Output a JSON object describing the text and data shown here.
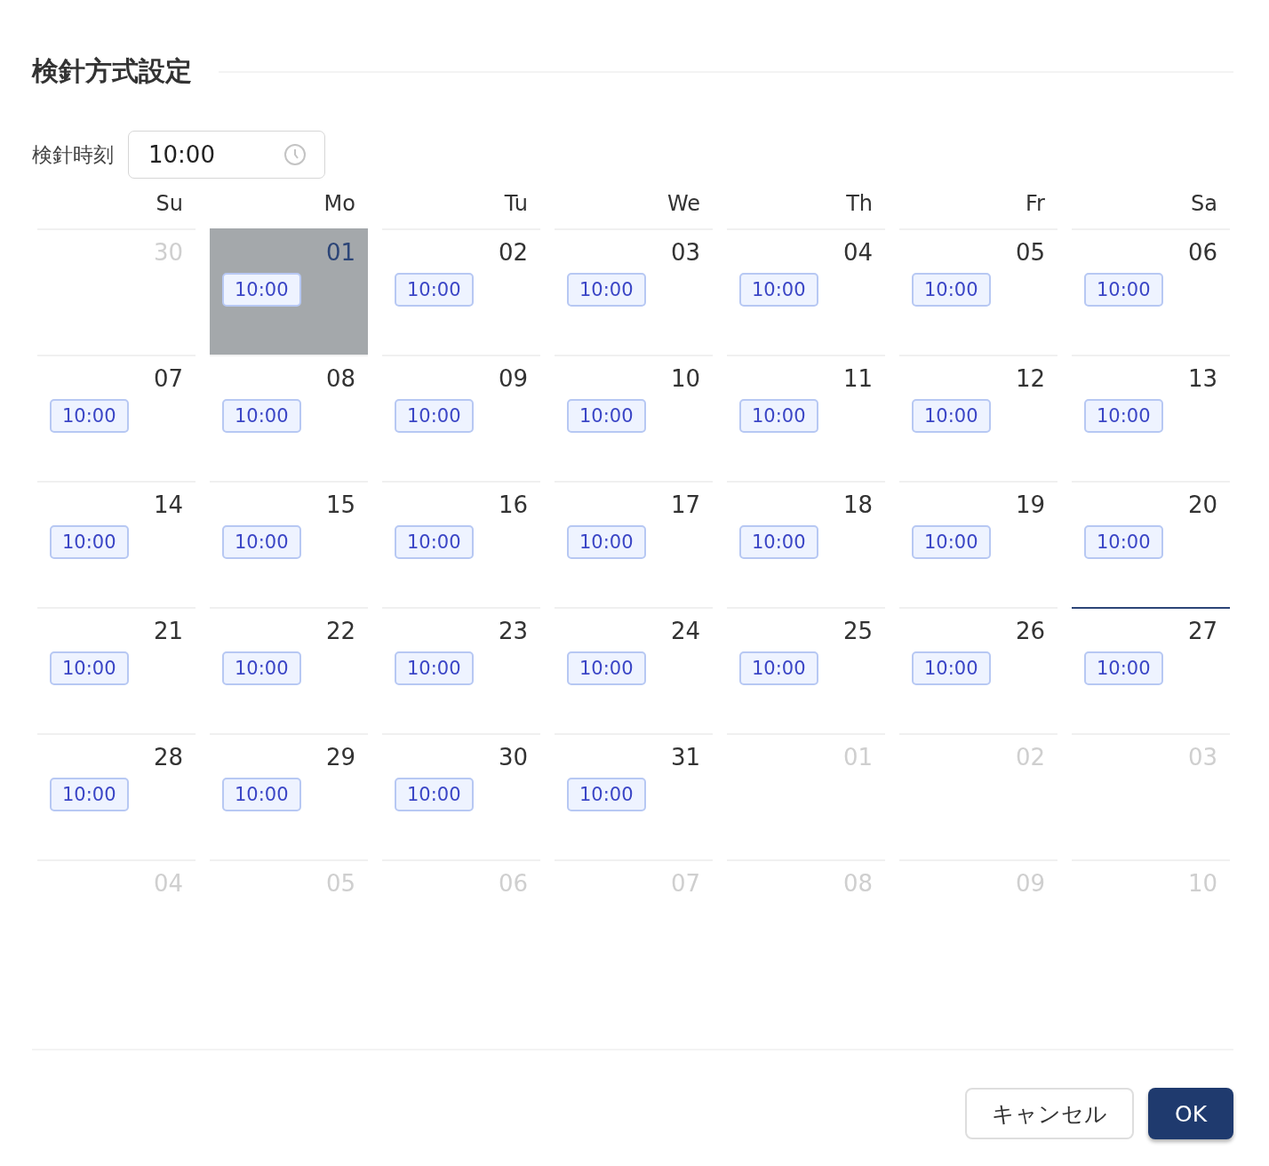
{
  "dialog": {
    "title": "検針方式設定"
  },
  "time_field": {
    "label": "検針時刻",
    "value": "10:00"
  },
  "calendar": {
    "weekdays": [
      "Su",
      "Mo",
      "Tu",
      "We",
      "Th",
      "Fr",
      "Sa"
    ],
    "weeks": [
      [
        {
          "day": "30",
          "muted": true,
          "selected": false,
          "today": false
        },
        {
          "day": "01",
          "muted": false,
          "selected": true,
          "today": false,
          "event": "10:00"
        },
        {
          "day": "02",
          "muted": false,
          "selected": false,
          "today": false,
          "event": "10:00"
        },
        {
          "day": "03",
          "muted": false,
          "selected": false,
          "today": false,
          "event": "10:00"
        },
        {
          "day": "04",
          "muted": false,
          "selected": false,
          "today": false,
          "event": "10:00"
        },
        {
          "day": "05",
          "muted": false,
          "selected": false,
          "today": false,
          "event": "10:00"
        },
        {
          "day": "06",
          "muted": false,
          "selected": false,
          "today": false,
          "event": "10:00"
        }
      ],
      [
        {
          "day": "07",
          "muted": false,
          "selected": false,
          "today": false,
          "event": "10:00"
        },
        {
          "day": "08",
          "muted": false,
          "selected": false,
          "today": false,
          "event": "10:00"
        },
        {
          "day": "09",
          "muted": false,
          "selected": false,
          "today": false,
          "event": "10:00"
        },
        {
          "day": "10",
          "muted": false,
          "selected": false,
          "today": false,
          "event": "10:00"
        },
        {
          "day": "11",
          "muted": false,
          "selected": false,
          "today": false,
          "event": "10:00"
        },
        {
          "day": "12",
          "muted": false,
          "selected": false,
          "today": false,
          "event": "10:00"
        },
        {
          "day": "13",
          "muted": false,
          "selected": false,
          "today": false,
          "event": "10:00"
        }
      ],
      [
        {
          "day": "14",
          "muted": false,
          "selected": false,
          "today": false,
          "event": "10:00"
        },
        {
          "day": "15",
          "muted": false,
          "selected": false,
          "today": false,
          "event": "10:00"
        },
        {
          "day": "16",
          "muted": false,
          "selected": false,
          "today": false,
          "event": "10:00"
        },
        {
          "day": "17",
          "muted": false,
          "selected": false,
          "today": false,
          "event": "10:00"
        },
        {
          "day": "18",
          "muted": false,
          "selected": false,
          "today": false,
          "event": "10:00"
        },
        {
          "day": "19",
          "muted": false,
          "selected": false,
          "today": false,
          "event": "10:00"
        },
        {
          "day": "20",
          "muted": false,
          "selected": false,
          "today": false,
          "event": "10:00"
        }
      ],
      [
        {
          "day": "21",
          "muted": false,
          "selected": false,
          "today": false,
          "event": "10:00"
        },
        {
          "day": "22",
          "muted": false,
          "selected": false,
          "today": false,
          "event": "10:00"
        },
        {
          "day": "23",
          "muted": false,
          "selected": false,
          "today": false,
          "event": "10:00"
        },
        {
          "day": "24",
          "muted": false,
          "selected": false,
          "today": false,
          "event": "10:00"
        },
        {
          "day": "25",
          "muted": false,
          "selected": false,
          "today": false,
          "event": "10:00"
        },
        {
          "day": "26",
          "muted": false,
          "selected": false,
          "today": false,
          "event": "10:00"
        },
        {
          "day": "27",
          "muted": false,
          "selected": false,
          "today": true,
          "event": "10:00"
        }
      ],
      [
        {
          "day": "28",
          "muted": false,
          "selected": false,
          "today": false,
          "event": "10:00"
        },
        {
          "day": "29",
          "muted": false,
          "selected": false,
          "today": false,
          "event": "10:00"
        },
        {
          "day": "30",
          "muted": false,
          "selected": false,
          "today": false,
          "event": "10:00"
        },
        {
          "day": "31",
          "muted": false,
          "selected": false,
          "today": false,
          "event": "10:00"
        },
        {
          "day": "01",
          "muted": true,
          "selected": false,
          "today": false
        },
        {
          "day": "02",
          "muted": true,
          "selected": false,
          "today": false
        },
        {
          "day": "03",
          "muted": true,
          "selected": false,
          "today": false
        }
      ],
      [
        {
          "day": "04",
          "muted": true,
          "selected": false,
          "today": false
        },
        {
          "day": "05",
          "muted": true,
          "selected": false,
          "today": false
        },
        {
          "day": "06",
          "muted": true,
          "selected": false,
          "today": false
        },
        {
          "day": "07",
          "muted": true,
          "selected": false,
          "today": false
        },
        {
          "day": "08",
          "muted": true,
          "selected": false,
          "today": false
        },
        {
          "day": "09",
          "muted": true,
          "selected": false,
          "today": false
        },
        {
          "day": "10",
          "muted": true,
          "selected": false,
          "today": false
        }
      ]
    ]
  },
  "buttons": [
    {
      "label": "キャンセル",
      "kind": "secondary"
    },
    {
      "label": "OK",
      "kind": "primary"
    }
  ]
}
